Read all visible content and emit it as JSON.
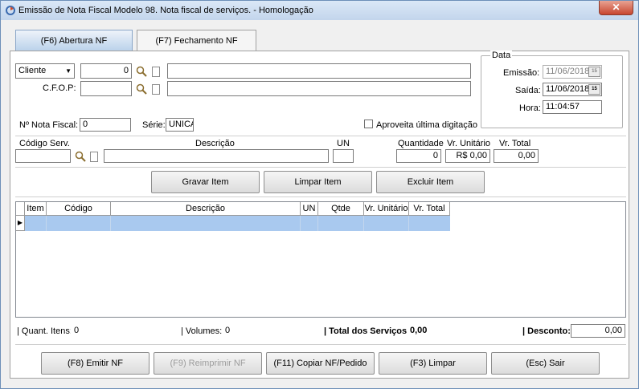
{
  "window": {
    "title": "Emissão de Nota Fiscal Modelo 98. Nota fiscal  de serviços. - Homologação",
    "close_glyph": "✕"
  },
  "tabs": [
    {
      "label": "(F6) Abertura NF",
      "active": true
    },
    {
      "label": "(F7) Fechamento NF",
      "active": false
    }
  ],
  "header": {
    "party_select": "Cliente",
    "client_code": "0",
    "client_name": "",
    "cfop_label": "C.F.O.P:",
    "cfop_code": "",
    "cfop_desc": "",
    "nf_number_label": "Nº Nota Fiscal:",
    "nf_number": "0",
    "serie_label": "Série:",
    "serie": "UNICA",
    "reuse_last_label": "Aproveita última digitação",
    "reuse_last_checked": false
  },
  "date_group": {
    "title": "Data",
    "emissao_label": "Emissão:",
    "emissao": "11/06/2018",
    "saida_label": "Saída:",
    "saida": "11/06/2018",
    "hora_label": "Hora:",
    "hora": "11:04:57",
    "calendar_glyph": "15"
  },
  "item_entry": {
    "codigo_label": "Código Serv.",
    "codigo": "",
    "descricao_label": "Descrição",
    "descricao": "",
    "un_label": "UN",
    "un": "",
    "quantidade_label": "Quantidade",
    "quantidade": "0",
    "vr_unitario_label": "Vr. Unitário",
    "vr_unitario": "R$ 0,00",
    "vr_total_label": "Vr. Total",
    "vr_total": "0,00"
  },
  "item_buttons": {
    "gravar": "Gravar Item",
    "limpar": "Limpar Item",
    "excluir": "Excluir Item"
  },
  "grid": {
    "columns": [
      "Item",
      "Código",
      "Descrição",
      "UN",
      "Qtde",
      "Vr. Unitário",
      "Vr. Total"
    ],
    "row_indicator": "▶"
  },
  "totals": {
    "quant_itens_label": "| Quant. Itens:",
    "quant_itens": "0",
    "volumes_label": "| Volumes:",
    "volumes": "0",
    "total_servicos_label": "| Total dos Serviços:",
    "total_servicos": "0,00",
    "desconto_label": "| Desconto:",
    "desconto": "0,00"
  },
  "footer_buttons": {
    "emitir": "(F8) Emitir NF",
    "reimprimir": "(F9) Reimprimir NF",
    "copiar": "(F11) Copiar NF/Pedido",
    "limpar": "(F3) Limpar",
    "sair": "(Esc) Sair"
  },
  "colors": {
    "selected_row": "#a9c9ef",
    "tab_active": "#b9d1ea"
  }
}
